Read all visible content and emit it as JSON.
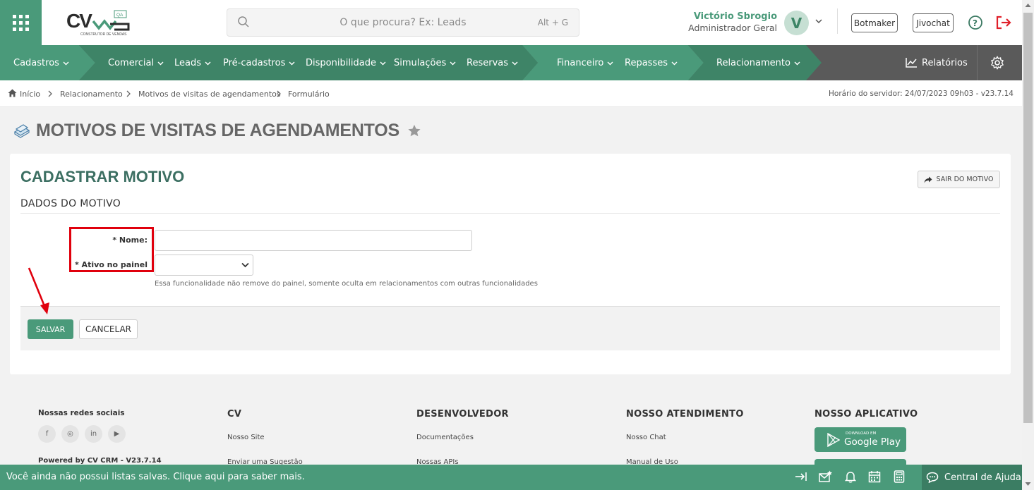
{
  "header": {
    "logo_text": "CV",
    "logo_badge": "QA",
    "logo_sub": "CONSTRUTOR DE VENDAS",
    "search_placeholder": "O que procura? Ex: Leads",
    "search_shortcut": "Alt + G",
    "user_name": "Victório Sbrogio",
    "user_role": "Administrador Geral",
    "avatar_initial": "V",
    "btn_botmaker": "Botmaker",
    "btn_jivochat": "Jivochat"
  },
  "nav": {
    "items": [
      {
        "label": "Cadastros"
      },
      {
        "label": "Comercial"
      },
      {
        "label": "Leads"
      },
      {
        "label": "Pré-cadastros"
      },
      {
        "label": "Disponibilidade"
      },
      {
        "label": "Simulações"
      },
      {
        "label": "Reservas"
      },
      {
        "label": "Financeiro"
      },
      {
        "label": "Repasses"
      },
      {
        "label": "Relacionamento"
      }
    ],
    "reports_label": "Relatórios",
    "colors": {
      "light": "#4a9a7a",
      "dark": "#3e8467",
      "gray": "#5a5a5a"
    }
  },
  "breadcrumb": {
    "items": [
      "Início",
      "Relacionamento",
      "Motivos de visitas de agendamentos",
      "Formulário"
    ],
    "server_time": "Horário do servidor: 24/07/2023 09h03 - v23.7.14"
  },
  "page": {
    "title": "MOTIVOS DE VISITAS DE AGENDAMENTOS"
  },
  "form": {
    "title": "CADASTRAR MOTIVO",
    "exit_label": "SAIR DO MOTIVO",
    "section": "DADOS DO MOTIVO",
    "name_label": "* Nome:",
    "name_value": "",
    "active_label": "* Ativo no painel",
    "active_value": "",
    "hint": "Essa funcionalidade não remove do painel, somente oculta em relacionamentos com outras funcionalidades",
    "save_label": "SALVAR",
    "cancel_label": "CANCELAR"
  },
  "footer": {
    "social_title": "Nossas redes sociais",
    "social_icons": [
      "f",
      "◎",
      "in",
      "▶"
    ],
    "powered": "Powered by CV CRM - V23.7.14",
    "cv_title": "CV",
    "cv_links": [
      "Nosso Site",
      "Enviar uma Sugestão"
    ],
    "dev_title": "DESENVOLVEDOR",
    "dev_links": [
      "Documentações",
      "Nossas APIs"
    ],
    "support_title": "NOSSO ATENDIMENTO",
    "support_links": [
      "Nosso Chat",
      "Manual de Uso"
    ],
    "app_title": "NOSSO APLICATIVO",
    "store_small": "DOWNLOAD EM",
    "store_name": "Google Play"
  },
  "bottombar": {
    "message": "Você ainda não possui listas salvas. Clique aqui para saber mais.",
    "help_center": "Central de Ajuda"
  },
  "annotations": {
    "highlight_color": "#e0000d"
  }
}
